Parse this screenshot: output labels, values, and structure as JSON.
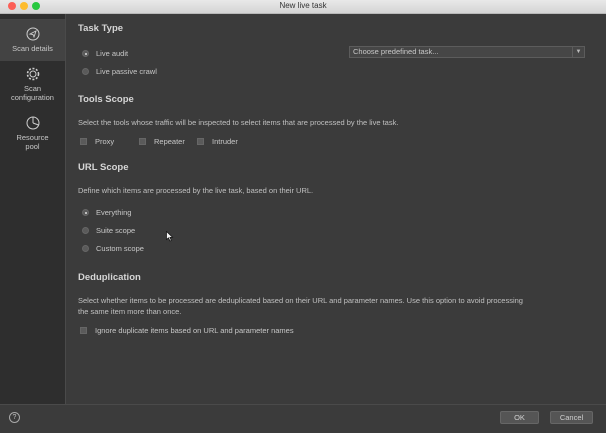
{
  "window": {
    "title": "New live task"
  },
  "sidebar": {
    "items": [
      {
        "label": "Scan details",
        "icon": "navigation-arrow-icon",
        "active": true
      },
      {
        "label": "Scan configuration",
        "icon": "gear-icon"
      },
      {
        "label": "Resource pool",
        "icon": "pie-chart-icon"
      }
    ]
  },
  "task_type": {
    "heading": "Task Type",
    "options": [
      {
        "label": "Live audit",
        "selected": true
      },
      {
        "label": "Live passive crawl",
        "selected": false
      }
    ],
    "predefined_placeholder": "Choose predefined task..."
  },
  "tools_scope": {
    "heading": "Tools Scope",
    "description": "Select the tools whose traffic will be inspected to select items that are processed by the live task.",
    "tools": [
      {
        "label": "Proxy",
        "checked": false
      },
      {
        "label": "Repeater",
        "checked": false
      },
      {
        "label": "Intruder",
        "checked": false
      }
    ]
  },
  "url_scope": {
    "heading": "URL Scope",
    "description": "Define which items are processed by the live task, based on their URL.",
    "options": [
      {
        "label": "Everything",
        "selected": true
      },
      {
        "label": "Suite scope",
        "selected": false
      },
      {
        "label": "Custom scope",
        "selected": false
      }
    ]
  },
  "dedup": {
    "heading": "Deduplication",
    "description_line1": "Select whether items to be processed are deduplicated based on their URL and parameter names. Use this option to avoid processing",
    "description_line2": "the same item more than once.",
    "checkbox_label": "Ignore duplicate items based on URL and parameter names",
    "checked": false
  },
  "footer": {
    "help_label": "?",
    "ok_label": "OK",
    "cancel_label": "Cancel"
  },
  "colors": {
    "background": "#3b3b3b",
    "sidebar": "#2e2e2e",
    "active_nav": "#434343"
  }
}
